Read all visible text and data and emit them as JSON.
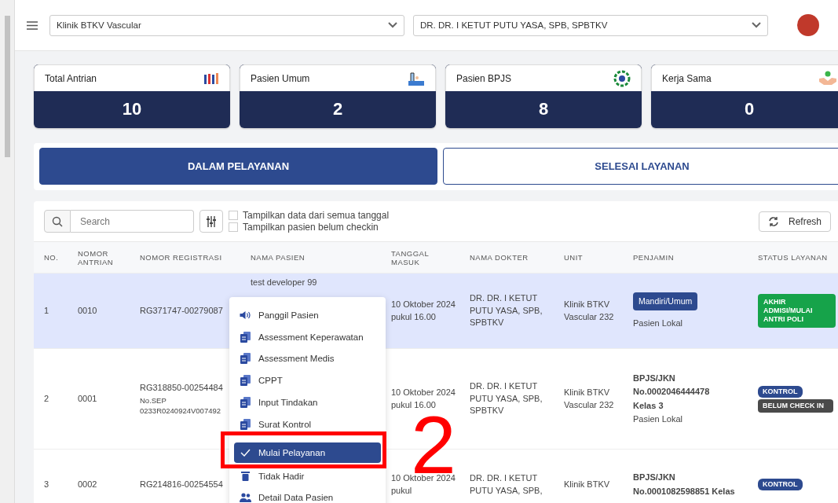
{
  "top_bar": {
    "clinic_select": "Klinik BTKV Vascular",
    "doctor_select": "DR. DR. I KETUT PUTU YASA, SPB, SPBTKV"
  },
  "stats": [
    {
      "label": "Total Antrian",
      "value": "10",
      "kind": "queue"
    },
    {
      "label": "Pasien Umum",
      "value": "2",
      "kind": "general"
    },
    {
      "label": "Pasien BPJS",
      "value": "8",
      "kind": "bpjs"
    },
    {
      "label": "Kerja Sama",
      "value": "0",
      "kind": "partner"
    }
  ],
  "tabs": [
    {
      "label": "DALAM PELAYANAN",
      "selected": true
    },
    {
      "label": "SELESAI LAYANAN",
      "selected": false
    }
  ],
  "toolbar": {
    "search_placeholder": "Search",
    "filters": [
      {
        "label": "Tampilkan data dari semua tanggal",
        "checked": false
      },
      {
        "label": "Tampilkan pasien belum checkin",
        "checked": false
      }
    ],
    "refresh": "Refresh"
  },
  "table": {
    "columns": [
      "NO.",
      "NOMOR ANTRIAN",
      "NOMOR REGISTRASI",
      "NAMA PASIEN",
      "TANGGAL MASUK",
      "NAMA DOKTER",
      "UNIT",
      "PENJAMIN",
      "STATUS LAYANAN"
    ],
    "rows": [
      {
        "selected": true,
        "no": "1",
        "antrian": "0010",
        "registrasi": "RG371747-00279087",
        "nama": "test developer 99",
        "tanggal": "10 Oktober 2024 pukul 16.00",
        "dokter": "DR. DR. I KETUT PUTU YASA, SPB, SPBTKV",
        "unit": "Klinik BTKV Vascular 232",
        "penjamin_badge": "Mandiri/Umum",
        "penjamin_lines": [
          {
            "text": "Pasien Lokal",
            "kind": "plain"
          }
        ],
        "status": [
          {
            "label": "AKHIR ADMISI/MULAI ANTRI POLI",
            "kind": "admission"
          }
        ]
      },
      {
        "selected": false,
        "no": "2",
        "antrian": "0001",
        "registrasi": "RG318850-00254484",
        "sep": "No.SEP 0233R0240924V007492",
        "tanggal": "10 Oktober 2024 pukul 16.00",
        "dokter": "DR. DR. I KETUT PUTU YASA, SPB, SPBTKV",
        "unit": "Klinik BTKV Vascular 232",
        "penjamin_lines": [
          {
            "text": "BPJS/JKN",
            "kind": "strong"
          },
          {
            "text": "No.0002046444478",
            "kind": "strong"
          },
          {
            "text": "Kelas 3",
            "kind": "strong"
          },
          {
            "text": "Pasien Lokal",
            "kind": "plain"
          }
        ],
        "status": [
          {
            "label": "KONTROL",
            "kind": "control"
          },
          {
            "label": "BELUM CHECK IN",
            "kind": "checkin"
          }
        ]
      },
      {
        "selected": false,
        "no": "3",
        "antrian": "0002",
        "registrasi": "RG214816-00254554",
        "tanggal": "10 Oktober 2024 pukul",
        "dokter": "DR. DR. I KETUT PUTU YASA, SPB,",
        "unit": "Klinik BTKV",
        "penjamin_lines": [
          {
            "text": "BPJS/JKN",
            "kind": "strong"
          },
          {
            "text": "No.0001082598851 Kelas",
            "kind": "strong"
          }
        ],
        "status": [
          {
            "label": "KONTROL",
            "kind": "control"
          }
        ]
      }
    ]
  },
  "context_menu": {
    "items": [
      {
        "label": "Panggil Pasien",
        "kind": "speaker",
        "selected": false
      },
      {
        "label": "Assessment Keperawatan",
        "kind": "document",
        "selected": false
      },
      {
        "label": "Assessment Medis",
        "kind": "document",
        "selected": false
      },
      {
        "label": "CPPT",
        "kind": "document",
        "selected": false
      },
      {
        "label": "Input Tindakan",
        "kind": "document",
        "selected": false
      },
      {
        "label": "Surat Kontrol",
        "kind": "document",
        "selected": false
      },
      {
        "label": "Mulai Pelayanan",
        "kind": "check",
        "selected": true
      },
      {
        "label": "Tidak Hadir",
        "kind": "trash",
        "selected": false
      },
      {
        "label": "Detail Data Pasien",
        "kind": "people",
        "selected": false
      }
    ]
  },
  "annotation": {
    "label": "2"
  }
}
